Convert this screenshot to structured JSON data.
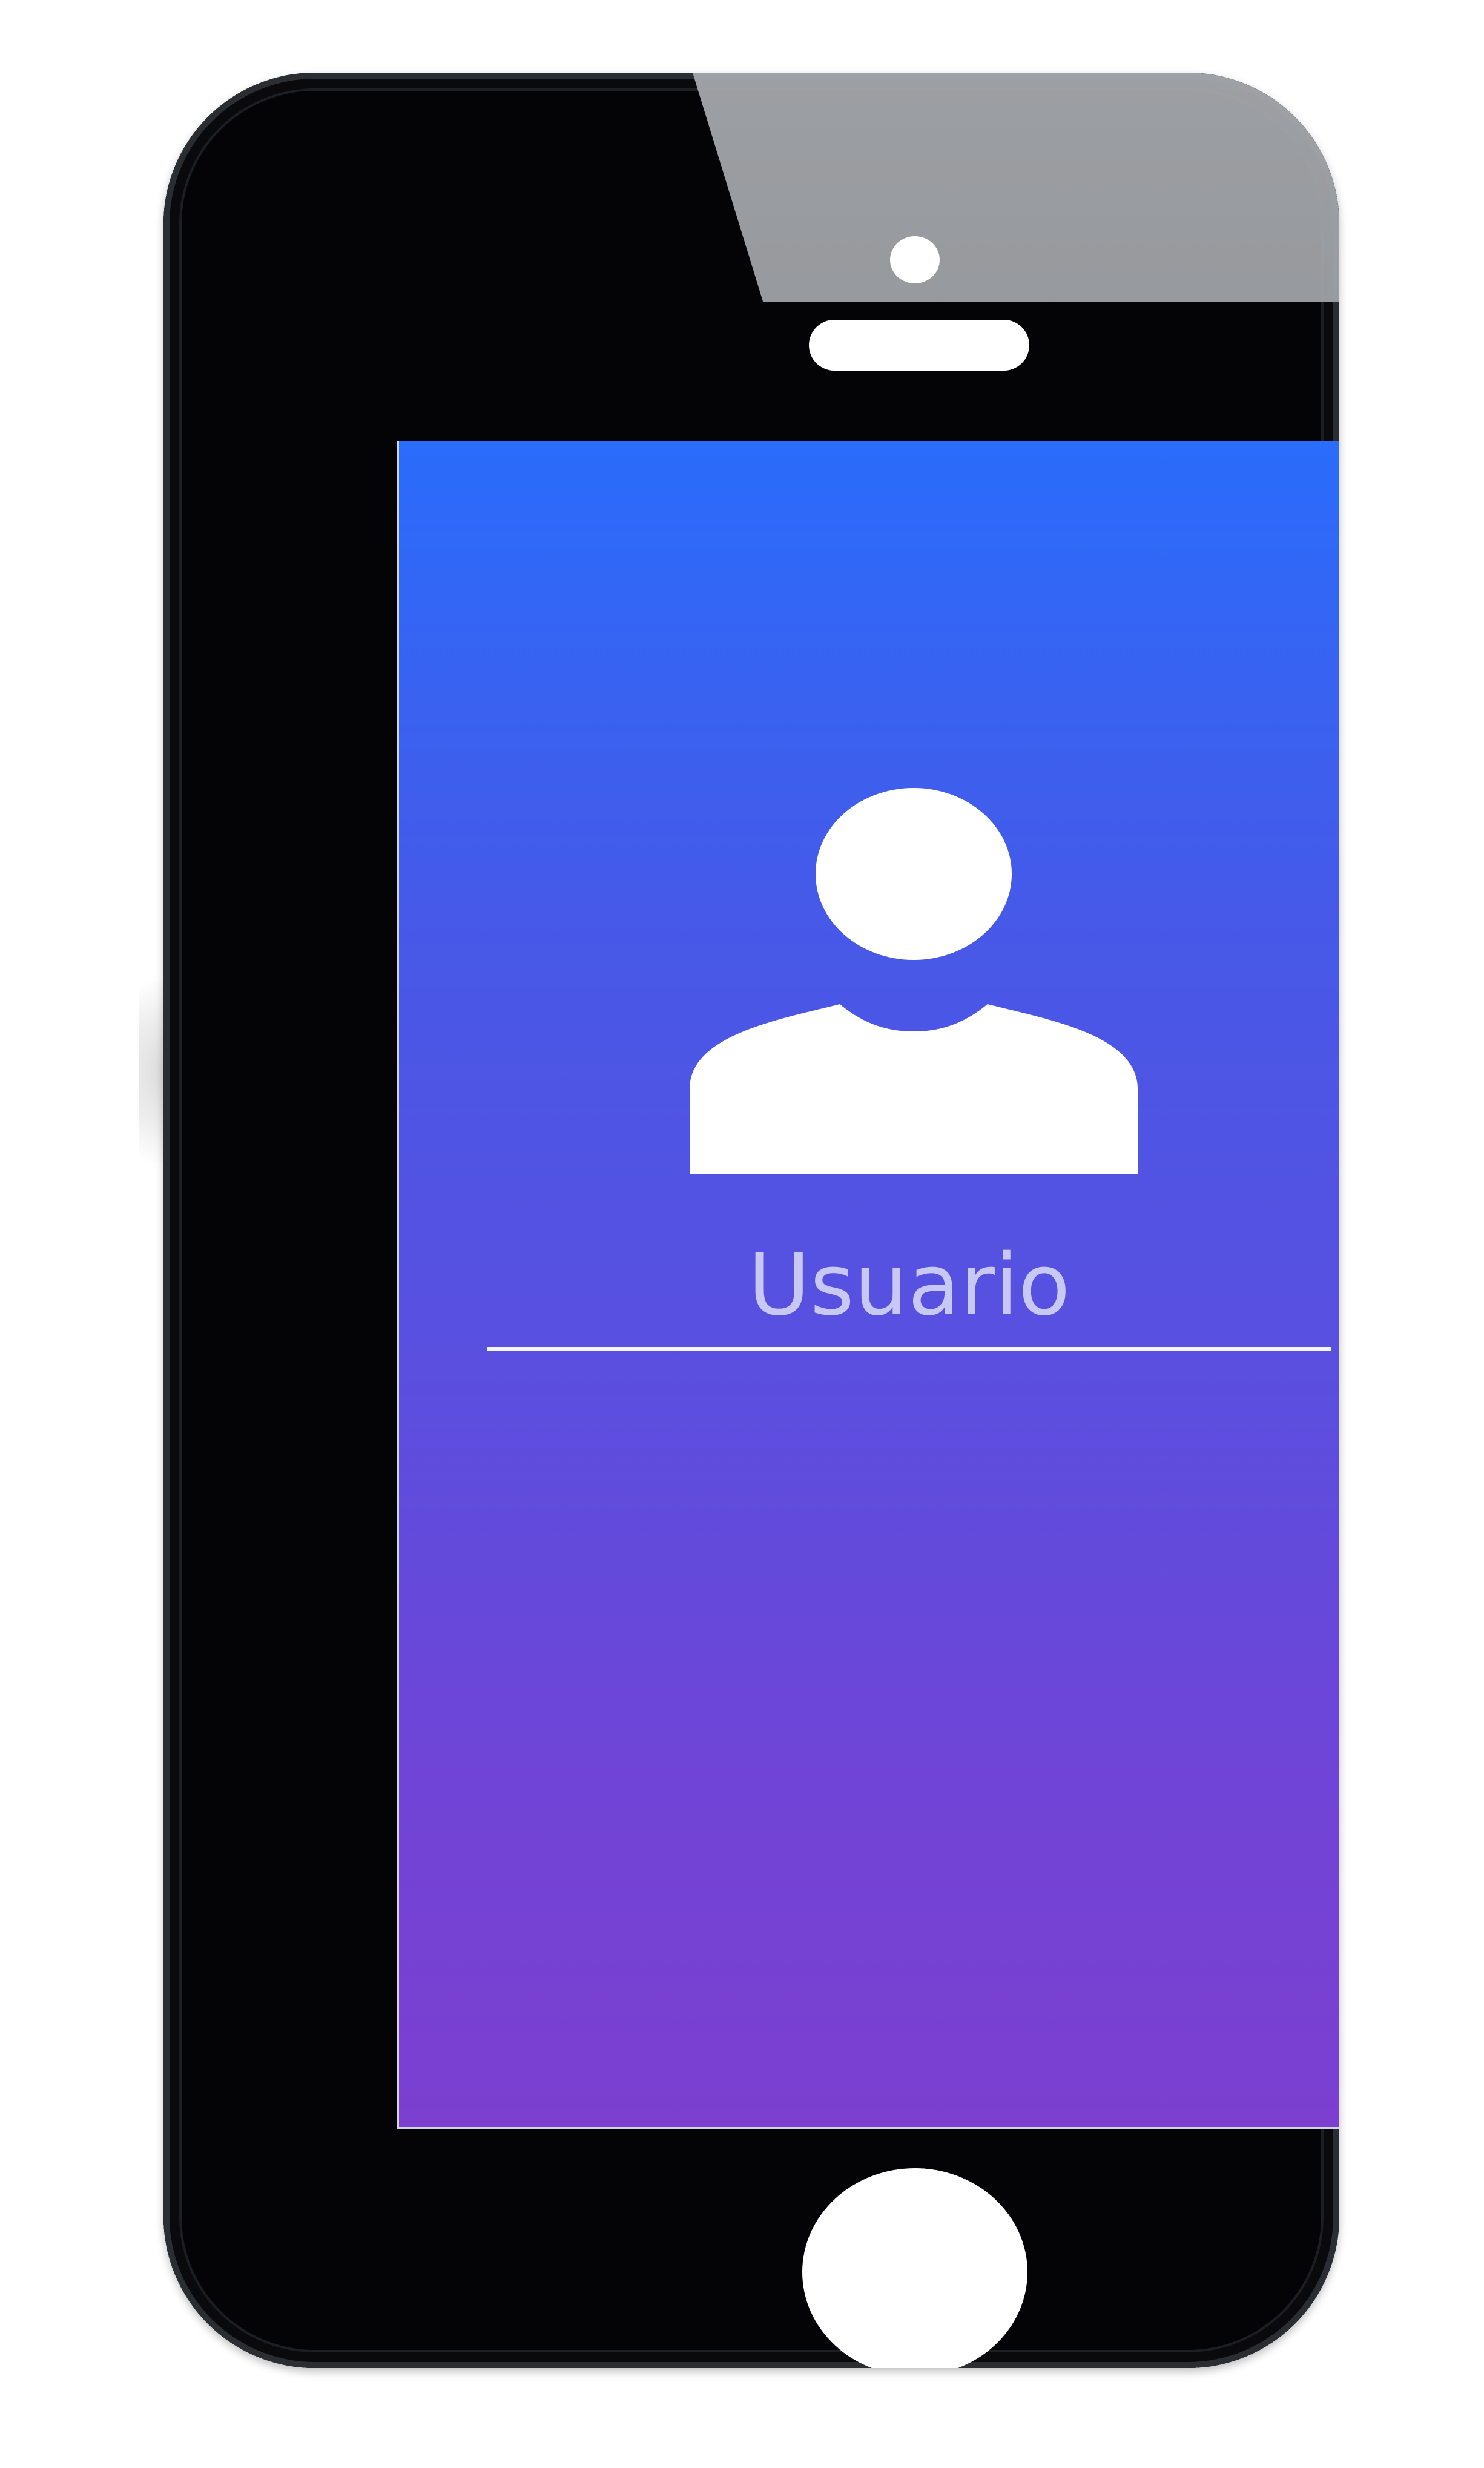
{
  "device": {
    "type": "smartphone",
    "body_color": "#040305",
    "camera_icon": "camera-dot",
    "speaker_icon": "earpiece-speaker"
  },
  "screen": {
    "gradient_colors": [
      "#2a6cfb",
      "#7c3fd0"
    ],
    "avatar_icon": "user-silhouette",
    "username_field": {
      "placeholder": "Usuario",
      "value": ""
    }
  },
  "home_button_icon": "home-button"
}
